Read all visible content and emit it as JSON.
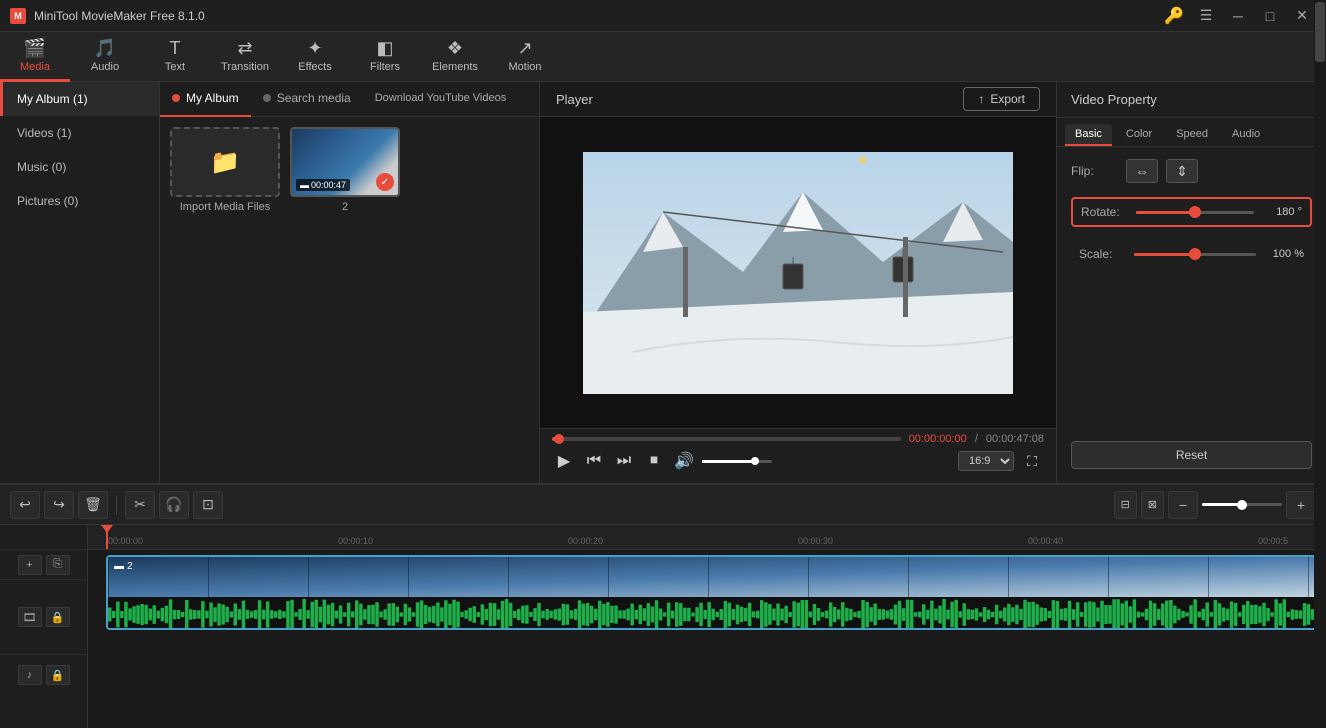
{
  "app": {
    "title": "MiniTool MovieMaker Free 8.1.0"
  },
  "titlebar": {
    "title": "MiniTool MovieMaker Free 8.1.0",
    "controls": [
      "minimize",
      "maximize",
      "close"
    ]
  },
  "toolbar": {
    "items": [
      {
        "id": "media",
        "label": "Media",
        "active": true
      },
      {
        "id": "audio",
        "label": "Audio",
        "active": false
      },
      {
        "id": "text",
        "label": "Text",
        "active": false
      },
      {
        "id": "transition",
        "label": "Transition",
        "active": false
      },
      {
        "id": "effects",
        "label": "Effects",
        "active": false
      },
      {
        "id": "filters",
        "label": "Filters",
        "active": false
      },
      {
        "id": "elements",
        "label": "Elements",
        "active": false
      },
      {
        "id": "motion",
        "label": "Motion",
        "active": false
      }
    ]
  },
  "leftpanel": {
    "items": [
      {
        "label": "My Album (1)",
        "active": true
      },
      {
        "label": "Videos (1)",
        "active": false
      },
      {
        "label": "Music (0)",
        "active": false
      },
      {
        "label": "Pictures (0)",
        "active": false
      }
    ]
  },
  "mediatabs": {
    "album": "My Album",
    "search": "Search media",
    "download": "Download YouTube Videos"
  },
  "mediaitems": [
    {
      "type": "import",
      "label": "Import Media Files"
    },
    {
      "type": "video",
      "label": "2",
      "duration": "00:00:47",
      "checked": true
    }
  ],
  "player": {
    "title": "Player",
    "export_label": "Export",
    "time_current": "00:00:00:00",
    "time_separator": "/",
    "time_total": "00:00:47:08",
    "aspect_ratio": "16:9"
  },
  "controls": {
    "play": "▶",
    "rewind": "⏮",
    "forward": "⏭",
    "stop": "⏹",
    "volume": "🔊"
  },
  "videoproperties": {
    "title": "Video Property",
    "tabs": [
      "Basic",
      "Color",
      "Speed",
      "Audio"
    ],
    "active_tab": "Basic",
    "flip_label": "Flip:",
    "rotate_label": "Rotate:",
    "rotate_value": "180 °",
    "rotate_percent": 50,
    "scale_label": "Scale:",
    "scale_value": "100 %",
    "scale_percent": 50,
    "reset_label": "Reset"
  },
  "timeline": {
    "ruler_marks": [
      "00:00:00",
      "00:00:10",
      "00:00:20",
      "00:00:30",
      "00:00:40",
      "00:00:5"
    ],
    "track_label": "2",
    "zoom_level": 50
  }
}
